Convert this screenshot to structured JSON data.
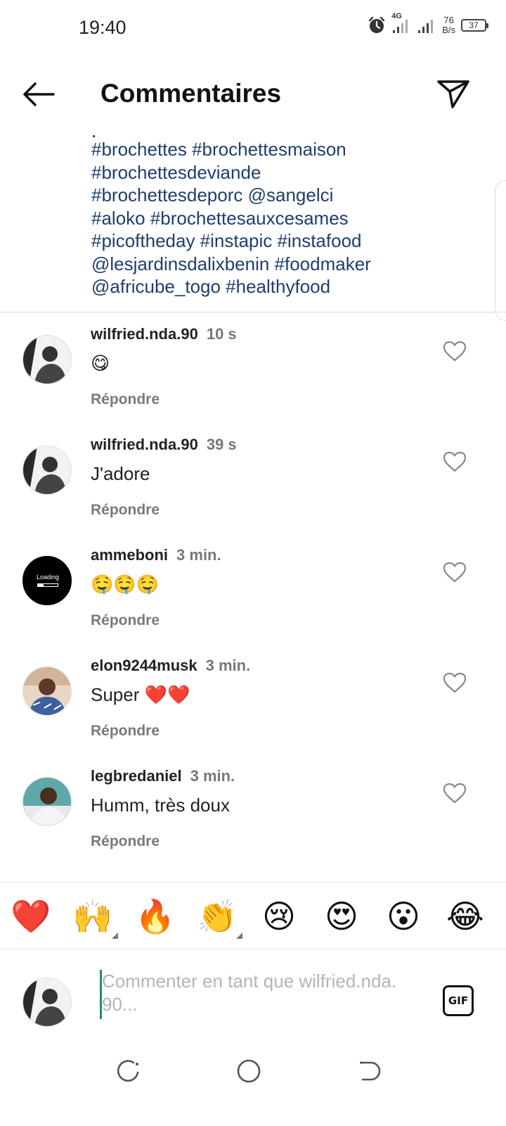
{
  "status_bar": {
    "time": "19:40",
    "network": "4G",
    "speed_value": "76",
    "speed_unit": "B/s",
    "battery": "37",
    "icons": [
      "alarm-icon",
      "signal-icon",
      "signal-icon",
      "battery-icon"
    ]
  },
  "header": {
    "title": "Commentaires",
    "back_icon": "arrow-left-icon",
    "send_icon": "paper-plane-icon"
  },
  "caption": {
    "dot": ".",
    "lines": [
      "#brochettes #brochettesmaison",
      "#brochettesdeviande",
      "#brochettesdeporc @sangelci",
      "#aloko #brochettesauxcesames",
      "#picoftheday #instapic #instafood",
      "@lesjardinsdalixbenin #foodmaker",
      "@africube_togo #healthyfood"
    ],
    "link_color": "#1e3e6e"
  },
  "comments": [
    {
      "user": "wilfried.nda.90",
      "time": "10 s",
      "text": "😋",
      "reply": "Répondre"
    },
    {
      "user": "wilfried.nda.90",
      "time": "39 s",
      "text": "J'adore",
      "reply": "Répondre"
    },
    {
      "user": "ammeboni",
      "time": "3 min.",
      "text": "🤤🤤🤤",
      "reply": "Répondre",
      "avatar_text": "Loading"
    },
    {
      "user": "elon9244musk",
      "time": "3 min.",
      "text": "Super ❤️❤️",
      "reply": "Répondre"
    },
    {
      "user": "legbredaniel",
      "time": "3 min.",
      "text": "Humm, très doux",
      "reply": "Répondre"
    }
  ],
  "emoji_bar": [
    "❤️",
    "🙌",
    "🔥",
    "👏",
    "😢",
    "😍",
    "😮",
    "😂"
  ],
  "composer": {
    "placeholder": "Commenter en tant que wilfried.nda. 90...",
    "gif_label": "GIF"
  },
  "nav": {
    "icons": [
      "recent-apps-icon",
      "home-icon",
      "back-nav-icon"
    ]
  }
}
